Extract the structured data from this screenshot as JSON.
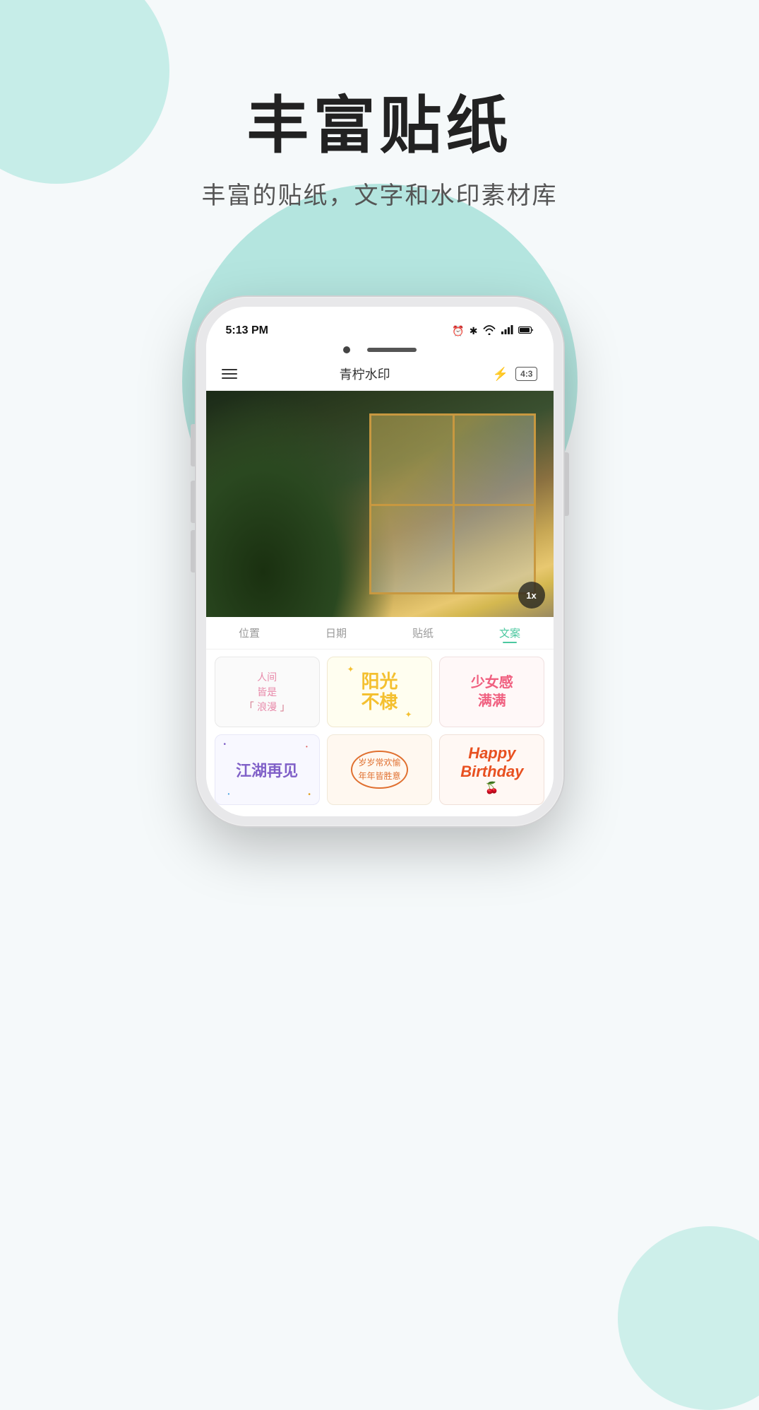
{
  "page": {
    "background_color": "#f5f9fa"
  },
  "header": {
    "main_title": "丰富贴纸",
    "sub_title": "丰富的贴纸，文字和水印素材库"
  },
  "phone": {
    "status_bar": {
      "time": "5:13 PM",
      "icons": [
        "alarm",
        "bluetooth",
        "wifi",
        "signal",
        "battery"
      ]
    },
    "toolbar": {
      "menu_label": "≡",
      "title": "青柠水印",
      "flash_icon": "⚡",
      "ratio": "4:3"
    },
    "camera": {
      "zoom_level": "1x"
    },
    "tabs": [
      {
        "id": "location",
        "label": "位置",
        "active": false
      },
      {
        "id": "date",
        "label": "日期",
        "active": false
      },
      {
        "id": "sticker",
        "label": "贴纸",
        "active": false
      },
      {
        "id": "text",
        "label": "文案",
        "active": true
      }
    ],
    "stickers": [
      {
        "id": 1,
        "text": "人间\n皆是\n浪漫",
        "style": "pink-cursive",
        "prefix": "「",
        "suffix": "」"
      },
      {
        "id": 2,
        "text": "阳光\n不棣",
        "style": "yellow-bold",
        "decoration": "sparkles"
      },
      {
        "id": 3,
        "text": "少女感\n满满",
        "style": "pink-bold"
      },
      {
        "id": 4,
        "text": "江湖再见",
        "style": "purple-bold",
        "decoration": "confetti"
      },
      {
        "id": 5,
        "text": "岁岁常欢愉\n年年皆胜意",
        "style": "orange-rounded"
      },
      {
        "id": 6,
        "text": "Happy\nBirthday",
        "style": "red-italic"
      }
    ]
  }
}
